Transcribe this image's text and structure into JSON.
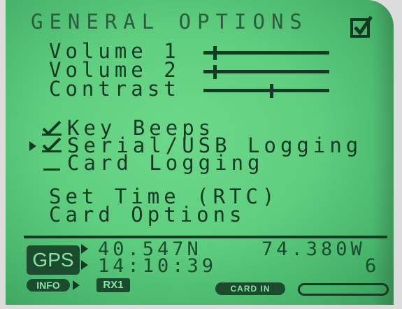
{
  "screen_title": "GENERAL OPTIONS",
  "icons": {
    "enabled_check": "checkbox-checked-icon",
    "selection_cursor": "triangle-right-icon",
    "option_check": "checkmark-icon"
  },
  "sliders": [
    {
      "label": "Volume 1",
      "level": 0.05
    },
    {
      "label": "Volume 2",
      "level": 0.05
    },
    {
      "label": "Contrast",
      "level": 0.5
    }
  ],
  "options": [
    {
      "label": "Key Beeps",
      "checked": true,
      "selected": false
    },
    {
      "label": "Serial/USB Logging",
      "checked": true,
      "selected": true
    },
    {
      "label": "Card Logging",
      "checked": false,
      "selected": false
    }
  ],
  "menu": [
    "Set Time (RTC)",
    "Card Options"
  ],
  "status": {
    "gps_badge": "GPS",
    "latitude": "40.547N",
    "longitude": "74.380W",
    "time": "14:10:39",
    "satellites": "6",
    "info_badge": "INFO",
    "rx_badge": "RX1",
    "card_badge": "CARD IN",
    "card_fill": 0
  },
  "colors": {
    "lcd_background": "#5fce7f",
    "lcd_ink": "#153a24",
    "badge_text": "#8ae3a3"
  }
}
